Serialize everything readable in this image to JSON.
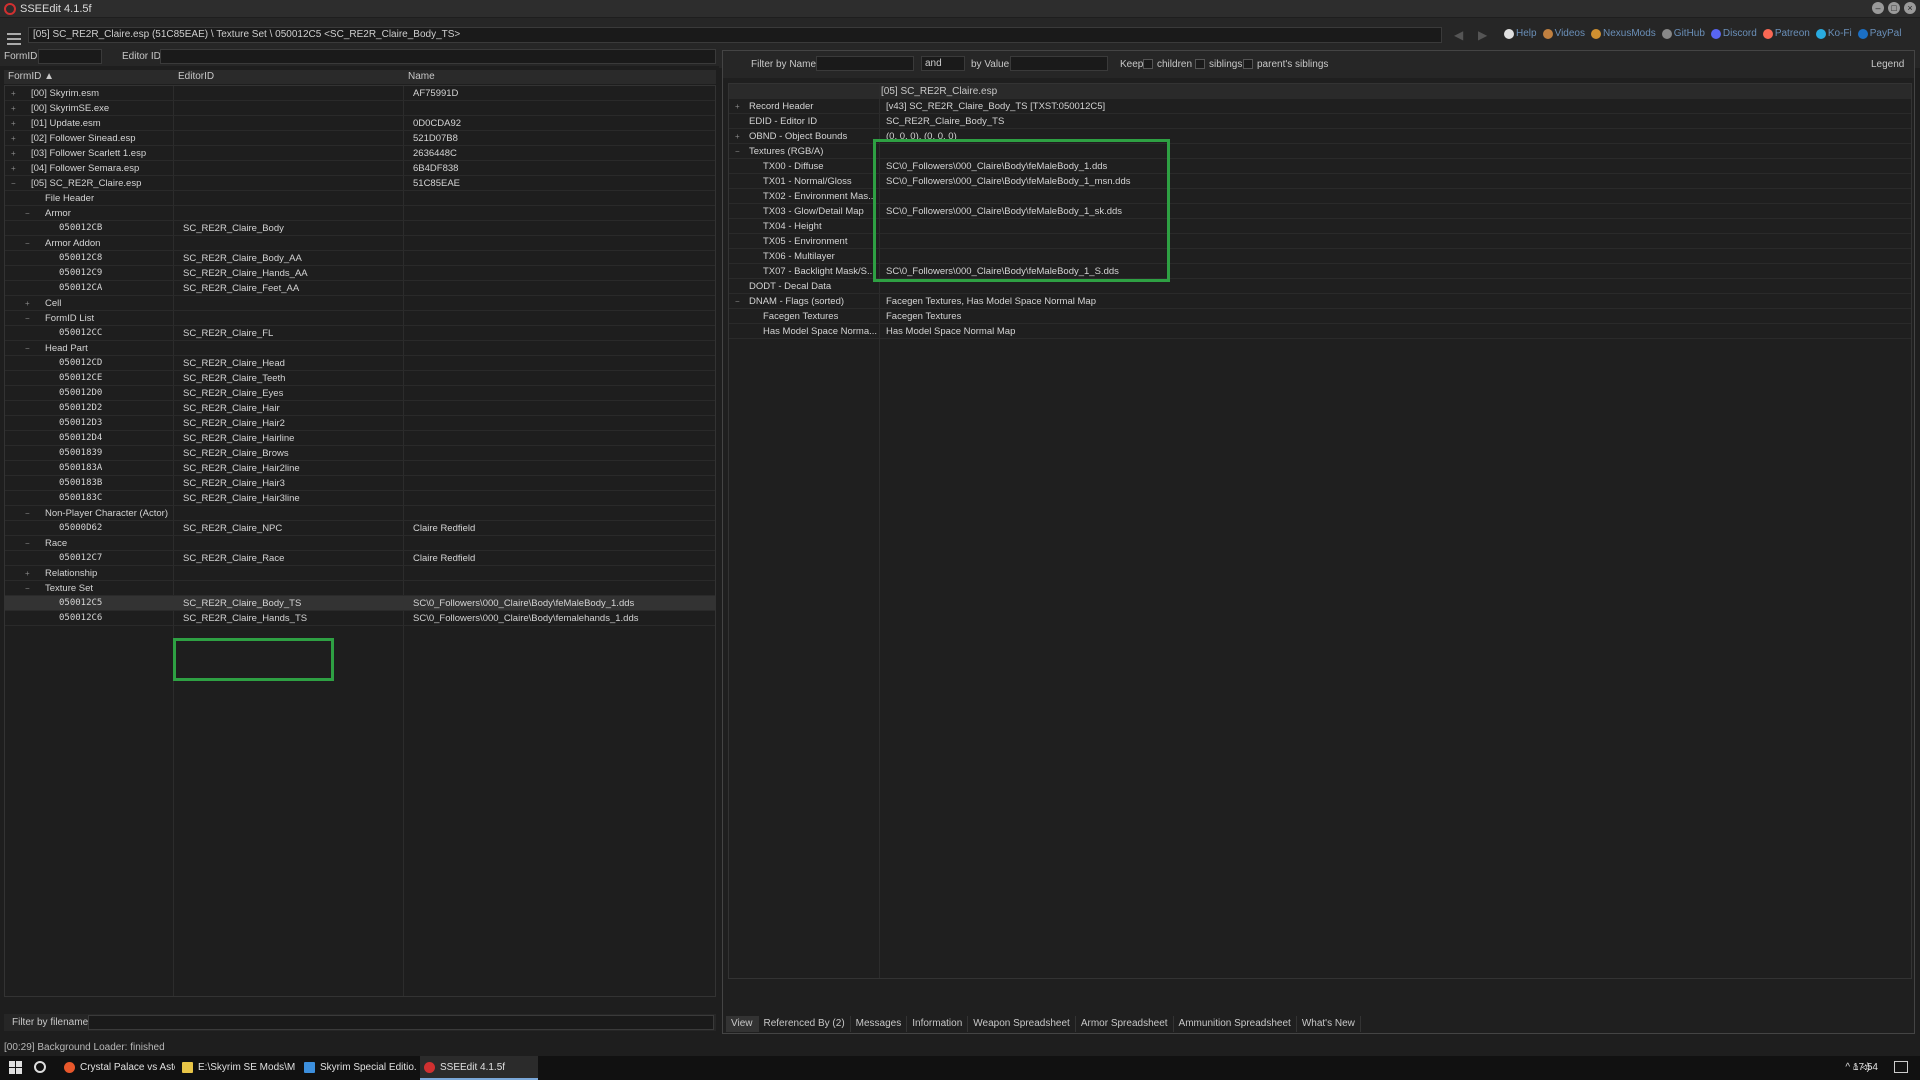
{
  "window": {
    "title": "SSEEdit 4.1.5f"
  },
  "pathbar": {
    "path": "[05] SC_RE2R_Claire.esp (51C85EAE) \\ Texture Set \\ 050012C5 <SC_RE2R_Claire_Body_TS>"
  },
  "links": [
    "Help",
    "Videos",
    "NexusMods",
    "GitHub",
    "Discord",
    "Patreon",
    "Ko-Fi",
    "PayPal"
  ],
  "left_filter": {
    "formid_label": "FormID",
    "editorid_label": "Editor ID"
  },
  "columns": {
    "formid": "FormID ▲",
    "editorid": "EditorID",
    "name": "Name"
  },
  "tree_rows": [
    {
      "level": 0,
      "exp": "+",
      "formid": "[00] Skyrim.esm",
      "editorid": "",
      "name": "AF75991D"
    },
    {
      "level": 0,
      "exp": "+",
      "formid": "[00] SkyrimSE.exe",
      "editorid": "",
      "name": ""
    },
    {
      "level": 0,
      "exp": "+",
      "formid": "[01] Update.esm",
      "editorid": "",
      "name": "0D0CDA92"
    },
    {
      "level": 0,
      "exp": "+",
      "formid": "[02] Follower Sinead.esp",
      "editorid": "",
      "name": "521D07B8"
    },
    {
      "level": 0,
      "exp": "+",
      "formid": "[03] Follower Scarlett 1.esp",
      "editorid": "",
      "name": "2636448C"
    },
    {
      "level": 0,
      "exp": "+",
      "formid": "[04] Follower Semara.esp",
      "editorid": "",
      "name": "6B4DF838"
    },
    {
      "level": 0,
      "exp": "−",
      "formid": "[05] SC_RE2R_Claire.esp",
      "editorid": "",
      "name": "51C85EAE"
    },
    {
      "level": 1,
      "exp": "",
      "formid": "File Header",
      "editorid": "",
      "name": ""
    },
    {
      "level": 1,
      "exp": "−",
      "formid": "Armor",
      "editorid": "",
      "name": ""
    },
    {
      "level": 2,
      "exp": "",
      "formid": "050012CB",
      "editorid": "SC_RE2R_Claire_Body",
      "name": "",
      "mono": true
    },
    {
      "level": 1,
      "exp": "−",
      "formid": "Armor Addon",
      "editorid": "",
      "name": ""
    },
    {
      "level": 2,
      "exp": "",
      "formid": "050012C8",
      "editorid": "SC_RE2R_Claire_Body_AA",
      "name": "",
      "mono": true
    },
    {
      "level": 2,
      "exp": "",
      "formid": "050012C9",
      "editorid": "SC_RE2R_Claire_Hands_AA",
      "name": "",
      "mono": true
    },
    {
      "level": 2,
      "exp": "",
      "formid": "050012CA",
      "editorid": "SC_RE2R_Claire_Feet_AA",
      "name": "",
      "mono": true
    },
    {
      "level": 1,
      "exp": "+",
      "formid": "Cell",
      "editorid": "",
      "name": ""
    },
    {
      "level": 1,
      "exp": "−",
      "formid": "FormID List",
      "editorid": "",
      "name": ""
    },
    {
      "level": 2,
      "exp": "",
      "formid": "050012CC",
      "editorid": "SC_RE2R_Claire_FL",
      "name": "",
      "mono": true
    },
    {
      "level": 1,
      "exp": "−",
      "formid": "Head Part",
      "editorid": "",
      "name": ""
    },
    {
      "level": 2,
      "exp": "",
      "formid": "050012CD",
      "editorid": "SC_RE2R_Claire_Head",
      "name": "",
      "mono": true
    },
    {
      "level": 2,
      "exp": "",
      "formid": "050012CE",
      "editorid": "SC_RE2R_Claire_Teeth",
      "name": "",
      "mono": true
    },
    {
      "level": 2,
      "exp": "",
      "formid": "050012D0",
      "editorid": "SC_RE2R_Claire_Eyes",
      "name": "",
      "mono": true
    },
    {
      "level": 2,
      "exp": "",
      "formid": "050012D2",
      "editorid": "SC_RE2R_Claire_Hair",
      "name": "",
      "mono": true
    },
    {
      "level": 2,
      "exp": "",
      "formid": "050012D3",
      "editorid": "SC_RE2R_Claire_Hair2",
      "name": "",
      "mono": true
    },
    {
      "level": 2,
      "exp": "",
      "formid": "050012D4",
      "editorid": "SC_RE2R_Claire_Hairline",
      "name": "",
      "mono": true
    },
    {
      "level": 2,
      "exp": "",
      "formid": "05001839",
      "editorid": "SC_RE2R_Claire_Brows",
      "name": "",
      "mono": true
    },
    {
      "level": 2,
      "exp": "",
      "formid": "0500183A",
      "editorid": "SC_RE2R_Claire_Hair2line",
      "name": "",
      "mono": true
    },
    {
      "level": 2,
      "exp": "",
      "formid": "0500183B",
      "editorid": "SC_RE2R_Claire_Hair3",
      "name": "",
      "mono": true
    },
    {
      "level": 2,
      "exp": "",
      "formid": "0500183C",
      "editorid": "SC_RE2R_Claire_Hair3line",
      "name": "",
      "mono": true
    },
    {
      "level": 1,
      "exp": "−",
      "formid": "Non-Player Character (Actor)",
      "editorid": "",
      "name": ""
    },
    {
      "level": 2,
      "exp": "",
      "formid": "05000D62",
      "editorid": "SC_RE2R_Claire_NPC",
      "name": "Claire Redfield",
      "mono": true
    },
    {
      "level": 1,
      "exp": "−",
      "formid": "Race",
      "editorid": "",
      "name": ""
    },
    {
      "level": 2,
      "exp": "",
      "formid": "050012C7",
      "editorid": "SC_RE2R_Claire_Race",
      "name": "Claire Redfield",
      "mono": true
    },
    {
      "level": 1,
      "exp": "+",
      "formid": "Relationship",
      "editorid": "",
      "name": ""
    },
    {
      "level": 1,
      "exp": "−",
      "formid": "Texture Set",
      "editorid": "",
      "name": ""
    },
    {
      "level": 2,
      "exp": "",
      "formid": "050012C5",
      "editorid": "SC_RE2R_Claire_Body_TS",
      "name": "SC\\0_Followers\\000_Claire\\Body\\feMaleBody_1.dds",
      "mono": true,
      "selected": true
    },
    {
      "level": 2,
      "exp": "",
      "formid": "050012C6",
      "editorid": "SC_RE2R_Claire_Hands_TS",
      "name": "SC\\0_Followers\\000_Claire\\Body\\femalehands_1.dds",
      "mono": true
    }
  ],
  "filename_filter": {
    "label": "Filter by filename:"
  },
  "right_filter": {
    "by_name": "Filter by Name:",
    "and": "and",
    "by_value": "by Value:",
    "keep": "Keep",
    "children": "children",
    "siblings": "siblings",
    "parents_siblings": "parent's siblings",
    "legend": "Legend"
  },
  "record_column": "[05] SC_RE2R_Claire.esp",
  "record_rows": [
    {
      "level": 0,
      "exp": "+",
      "key": "Record Header",
      "value": "[v43] SC_RE2R_Claire_Body_TS [TXST:050012C5]"
    },
    {
      "level": 0,
      "exp": "",
      "key": "EDID - Editor ID",
      "value": "SC_RE2R_Claire_Body_TS"
    },
    {
      "level": 0,
      "exp": "+",
      "key": "OBND - Object Bounds",
      "value": "(0, 0, 0), (0, 0, 0)"
    },
    {
      "level": 0,
      "exp": "−",
      "key": "Textures (RGB/A)",
      "value": ""
    },
    {
      "level": 1,
      "exp": "",
      "key": "TX00 - Diffuse",
      "value": "SC\\0_Followers\\000_Claire\\Body\\feMaleBody_1.dds"
    },
    {
      "level": 1,
      "exp": "",
      "key": "TX01 - Normal/Gloss",
      "value": "SC\\0_Followers\\000_Claire\\Body\\feMaleBody_1_msn.dds"
    },
    {
      "level": 1,
      "exp": "",
      "key": "TX02 - Environment Mas...",
      "value": ""
    },
    {
      "level": 1,
      "exp": "",
      "key": "TX03 - Glow/Detail Map",
      "value": "SC\\0_Followers\\000_Claire\\Body\\feMaleBody_1_sk.dds"
    },
    {
      "level": 1,
      "exp": "",
      "key": "TX04 - Height",
      "value": ""
    },
    {
      "level": 1,
      "exp": "",
      "key": "TX05 - Environment",
      "value": ""
    },
    {
      "level": 1,
      "exp": "",
      "key": "TX06 - Multilayer",
      "value": ""
    },
    {
      "level": 1,
      "exp": "",
      "key": "TX07 - Backlight Mask/S...",
      "value": "SC\\0_Followers\\000_Claire\\Body\\feMaleBody_1_S.dds"
    },
    {
      "level": 0,
      "exp": "",
      "key": "DODT - Decal Data",
      "value": ""
    },
    {
      "level": 0,
      "exp": "−",
      "key": "DNAM - Flags (sorted)",
      "value": "Facegen Textures, Has Model Space Normal Map"
    },
    {
      "level": 1,
      "exp": "",
      "key": "Facegen Textures",
      "value": "Facegen Textures"
    },
    {
      "level": 1,
      "exp": "",
      "key": "Has Model Space Norma...",
      "value": "Has Model Space Normal Map"
    }
  ],
  "tabs": [
    "View",
    "Referenced By (2)",
    "Messages",
    "Information",
    "Weapon Spreadsheet",
    "Armor Spreadsheet",
    "Ammunition Spreadsheet",
    "What's New"
  ],
  "status": "[00:29] Background Loader: finished",
  "taskbar": {
    "items": [
      "Crystal Palace vs Asto...",
      "E:\\Skyrim SE Mods\\M...",
      "Skyrim Special Editio...",
      "SSEEdit 4.1.5f"
    ],
    "clock": "17:54",
    "tray": "^ ⌂ ◃)"
  },
  "colors": {
    "highlight": "#2ea043",
    "link": "#6a8fb8"
  }
}
